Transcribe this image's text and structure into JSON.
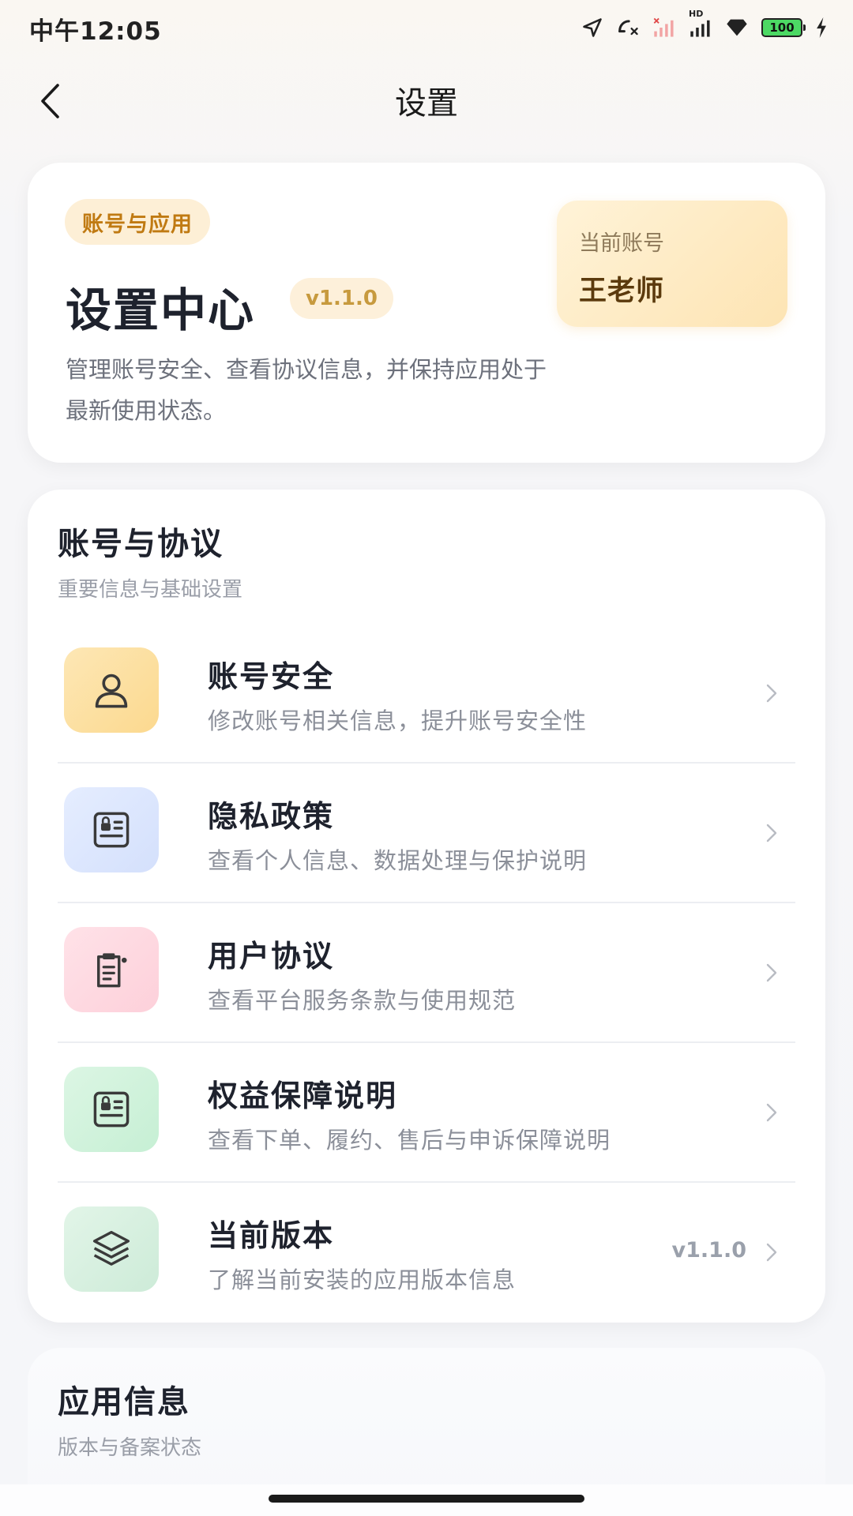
{
  "status_bar": {
    "time": "中午12:05",
    "battery": "100",
    "network_label": "HD"
  },
  "nav": {
    "title": "设置"
  },
  "hero": {
    "chip": "账号与应用",
    "title": "设置中心",
    "version": "v1.1.0",
    "description": "管理账号安全、查看协议信息，并保持应用处于最新使用状态。",
    "account_label": "当前账号",
    "account_name": "王老师"
  },
  "section_account": {
    "title": "账号与协议",
    "subtitle": "重要信息与基础设置",
    "items": [
      {
        "title": "账号安全",
        "desc": "修改账号相关信息，提升账号安全性",
        "icon": "user-icon",
        "value": ""
      },
      {
        "title": "隐私政策",
        "desc": "查看个人信息、数据处理与保护说明",
        "icon": "id-card-icon",
        "value": ""
      },
      {
        "title": "用户协议",
        "desc": "查看平台服务条款与使用规范",
        "icon": "document-icon",
        "value": ""
      },
      {
        "title": "权益保障说明",
        "desc": "查看下单、履约、售后与申诉保障说明",
        "icon": "id-card-icon",
        "value": ""
      },
      {
        "title": "当前版本",
        "desc": "了解当前安装的应用版本信息",
        "icon": "layers-icon",
        "value": "v1.1.0"
      }
    ]
  },
  "section_app": {
    "title": "应用信息",
    "subtitle": "版本与备案状态"
  },
  "colors": {
    "accent": "#c07a12",
    "text_primary": "#1e222d",
    "text_secondary": "#8b8f99"
  }
}
